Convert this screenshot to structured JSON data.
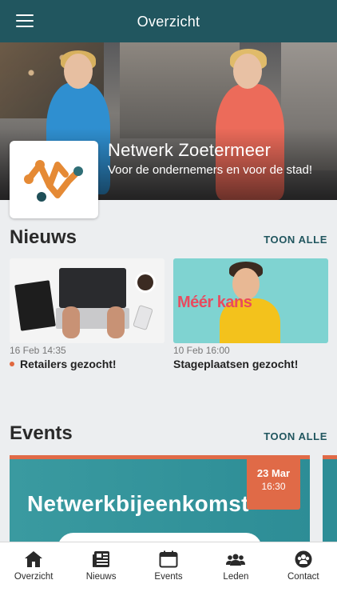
{
  "header": {
    "title": "Overzicht",
    "menu_icon": "hamburger-menu-icon"
  },
  "hero": {
    "org_name": "Netwerk Zoetermeer",
    "tagline": "Voor de ondernemers en voor de stad!"
  },
  "news": {
    "title": "Nieuws",
    "show_all": "TOON ALLE",
    "items": [
      {
        "date": "16 Feb 14:35",
        "title": "Retailers gezocht!",
        "unread": true
      },
      {
        "date": "10 Feb 16:00",
        "title": "Stageplaatsen gezocht!",
        "unread": false,
        "image_text": "Méér kans"
      }
    ]
  },
  "events": {
    "title": "Events",
    "show_all": "TOON ALLE",
    "items": [
      {
        "title": "Netwerkbijeenkomst",
        "date_day": "23 Mar",
        "date_time": "16:30"
      }
    ]
  },
  "tabbar": {
    "items": [
      {
        "label": "Overzicht",
        "icon": "home-icon"
      },
      {
        "label": "Nieuws",
        "icon": "newspaper-icon"
      },
      {
        "label": "Events",
        "icon": "calendar-icon"
      },
      {
        "label": "Leden",
        "icon": "members-icon"
      },
      {
        "label": "Contact",
        "icon": "contact-icon"
      }
    ]
  },
  "colors": {
    "primary": "#21565f",
    "accent": "#e06a47",
    "event_bg": "#2d8d96"
  }
}
